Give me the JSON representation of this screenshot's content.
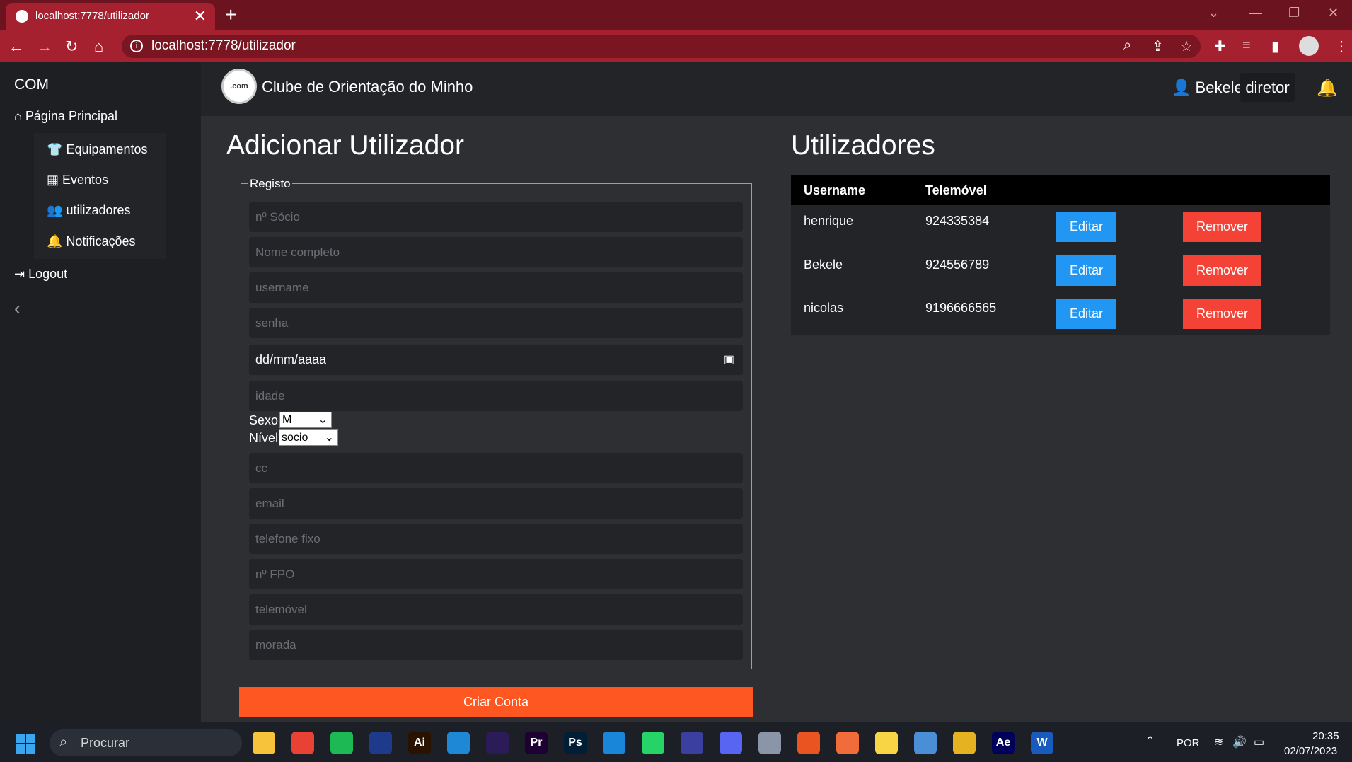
{
  "browser": {
    "tab_title": "localhost:7778/utilizador",
    "tab_close": "✕",
    "new_tab": "+",
    "url": "localhost:7778/utilizador"
  },
  "sidebar": {
    "brand": "COM",
    "main_item": "Página Principal",
    "items": [
      {
        "label": "Equipamentos",
        "icon": "shirt-icon"
      },
      {
        "label": "Eventos",
        "icon": "calendar-icon"
      },
      {
        "label": "utilizadores",
        "icon": "users-icon"
      },
      {
        "label": "Notificações",
        "icon": "bell-icon"
      }
    ],
    "logout": "Logout",
    "collapse": "‹"
  },
  "header": {
    "logo_text": ".com",
    "club_name": "Clube de Orientação do Minho",
    "user_name": "Bekele",
    "role": "diretor"
  },
  "form": {
    "title": "Adicionar Utilizador",
    "legend": "Registo",
    "placeholders": {
      "socio": "nº Sócio",
      "nome": "Nome completo",
      "username": "username",
      "senha": "senha",
      "idade": "idade",
      "cc": "cc",
      "email": "email",
      "telefone": "telefone fixo",
      "fpo": "nº FPO",
      "telemovel": "telemóvel",
      "morada": "morada"
    },
    "date_value": "dd/mm/aaaa",
    "sexo_label": "Sexo",
    "sexo_value": "M",
    "nivel_label": "Nível",
    "nivel_value": "socio",
    "submit": "Criar Conta"
  },
  "users": {
    "title": "Utilizadores",
    "columns": [
      "Username",
      "Telemóvel"
    ],
    "rows": [
      {
        "username": "henrique",
        "telemovel": "924335384"
      },
      {
        "username": "Bekele",
        "telemovel": "924556789"
      },
      {
        "username": "nicolas",
        "telemovel": "9196666565"
      }
    ],
    "edit_label": "Editar",
    "remove_label": "Remover"
  },
  "taskbar": {
    "search": "Procurar",
    "lang": "POR",
    "time": "20:35",
    "date": "02/07/2023",
    "apps": [
      {
        "name": "file-explorer",
        "label": "",
        "color": "#f6c33a"
      },
      {
        "name": "chrome",
        "label": "",
        "color": "#e94235"
      },
      {
        "name": "spotify",
        "label": "",
        "color": "#1db954"
      },
      {
        "name": "app-4",
        "label": "",
        "color": "#1e3a8a"
      },
      {
        "name": "illustrator",
        "label": "Ai",
        "color": "#2a1200"
      },
      {
        "name": "vscode",
        "label": "",
        "color": "#1f88d6"
      },
      {
        "name": "premiere-elements",
        "label": "",
        "color": "#2b1b57"
      },
      {
        "name": "premiere",
        "label": "Pr",
        "color": "#1e0033"
      },
      {
        "name": "photoshop",
        "label": "Ps",
        "color": "#001e36"
      },
      {
        "name": "mail",
        "label": "",
        "color": "#1a86d9"
      },
      {
        "name": "whatsapp",
        "label": "",
        "color": "#25d366"
      },
      {
        "name": "app-12",
        "label": "",
        "color": "#3b3fa0"
      },
      {
        "name": "discord",
        "label": "",
        "color": "#5865f2"
      },
      {
        "name": "app-14",
        "label": "",
        "color": "#8a96a8"
      },
      {
        "name": "ubuntu",
        "label": "",
        "color": "#e95420"
      },
      {
        "name": "app-16",
        "label": "",
        "color": "#f26b3a"
      },
      {
        "name": "bulb",
        "label": "",
        "color": "#f8d544"
      },
      {
        "name": "box",
        "label": "",
        "color": "#4a8fd6"
      },
      {
        "name": "app-19",
        "label": "",
        "color": "#e5b221"
      },
      {
        "name": "after-effects",
        "label": "Ae",
        "color": "#00005b"
      },
      {
        "name": "word",
        "label": "W",
        "color": "#185abd"
      }
    ]
  }
}
